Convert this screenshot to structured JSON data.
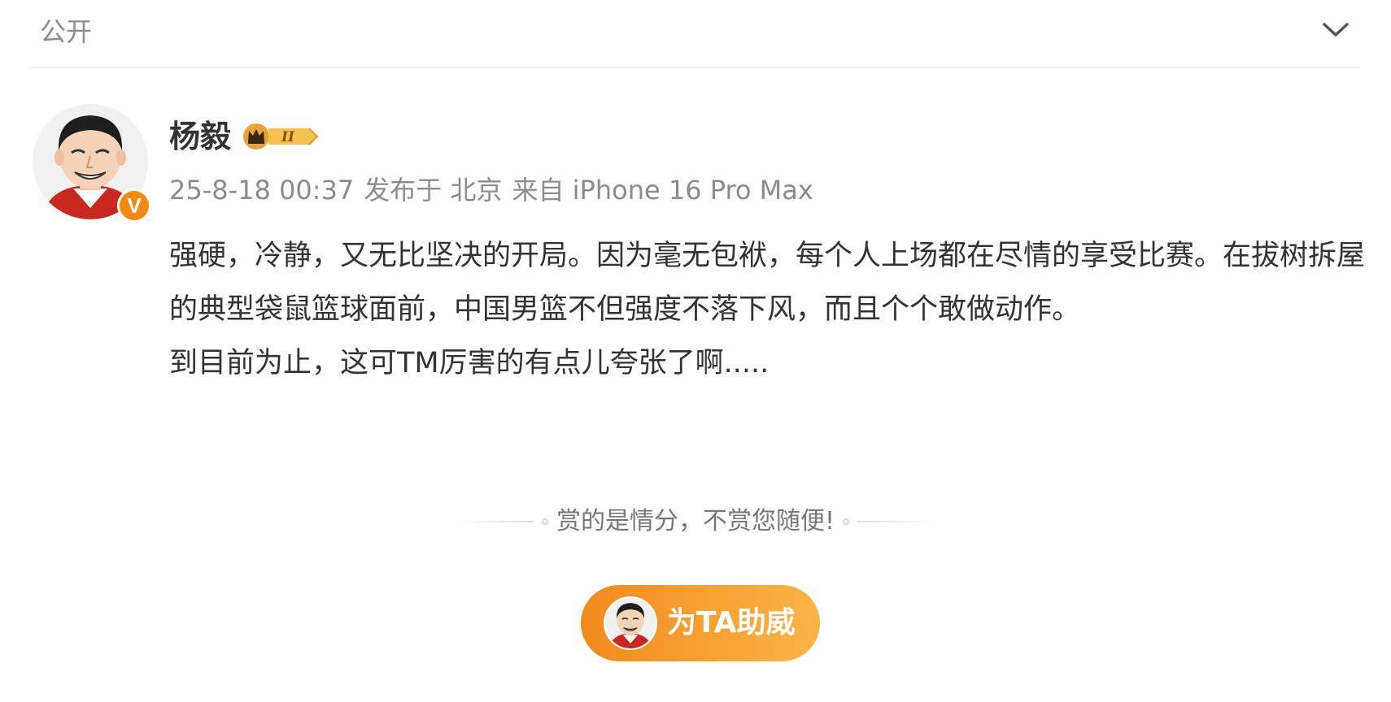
{
  "header": {
    "visibility": "公开",
    "dropdown_icon": "chevron-down-icon"
  },
  "post": {
    "author": {
      "name": "杨毅",
      "avatar_icon": "avatar",
      "verified_badge": "V",
      "verified_color": "#f28a12",
      "vip_level": "II",
      "vip_icon": "crown-icon"
    },
    "meta": {
      "timestamp": "25-8-18 00:37",
      "location": "发布于 北京",
      "device": "来自 iPhone 16 Pro Max"
    },
    "content": [
      "强硬，冷静，又无比坚决的开局。因为毫无包袱，每个人上场都在尽情的享受比赛。在拔树拆屋的典型袋鼠篮球面前，中国男篮不但强度不落下风，而且个个敢做动作。",
      "到目前为止，这可TM厉害的有点儿夸张了啊....."
    ]
  },
  "reward": {
    "text": "赏的是情分，不赏您随便!",
    "button_label": "为TA助威",
    "button_colors": [
      "#f08a1c",
      "#fbb545"
    ]
  }
}
